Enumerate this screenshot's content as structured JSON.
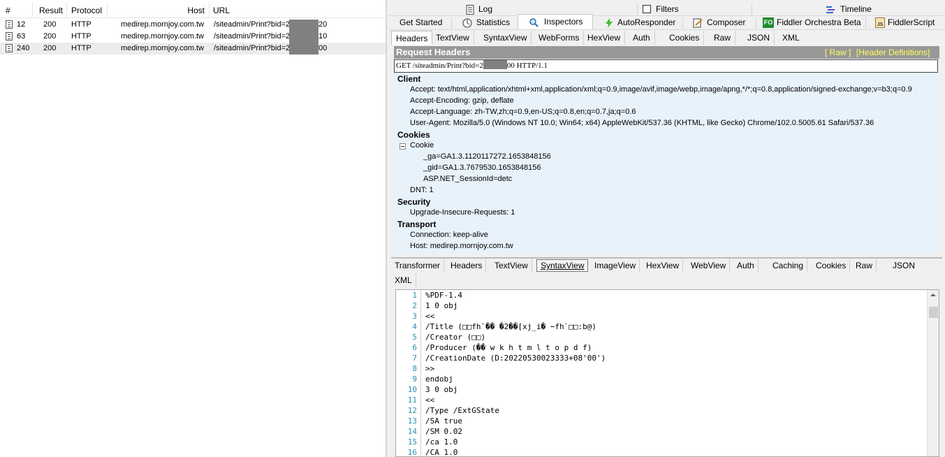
{
  "sessions": {
    "columns": [
      "#",
      "Result",
      "Protocol",
      "Host",
      "URL"
    ],
    "rows": [
      {
        "id": "12",
        "result": "200",
        "protocol": "HTTP",
        "host": "medirep.mornjoy.com.tw",
        "url": "/siteadmin/Print?bid=2",
        "url_tail": "20"
      },
      {
        "id": "63",
        "result": "200",
        "protocol": "HTTP",
        "host": "medirep.mornjoy.com.tw",
        "url": "/siteadmin/Print?bid=2",
        "url_tail": "10"
      },
      {
        "id": "240",
        "result": "200",
        "protocol": "HTTP",
        "host": "medirep.mornjoy.com.tw",
        "url": "/siteadmin/Print?bid=2",
        "url_tail": "00"
      }
    ]
  },
  "toptabs": {
    "log": "Log",
    "filters": "Filters",
    "timeline": "Timeline",
    "get_started": "Get Started",
    "statistics": "Statistics",
    "inspectors": "Inspectors",
    "autoresponder": "AutoResponder",
    "composer": "Composer",
    "orchestra": "Fiddler Orchestra Beta",
    "orchestra_badge": "FO",
    "fiddlerscript": "FiddlerScript",
    "fiddlerscript_badge": "JS"
  },
  "request_tabs": [
    "Headers",
    "TextView",
    "SyntaxView",
    "WebForms",
    "HexView",
    "Auth",
    "Cookies",
    "Raw",
    "JSON",
    "XML"
  ],
  "request_headers": {
    "title": "Request Headers",
    "raw_link": "[ Raw ]",
    "defs_link": "[Header Definitions]",
    "request_line_start": "GET /siteadmin/Print?bid=2",
    "request_line_end": "00 HTTP/1.1",
    "client_label": "Client",
    "accept": "Accept: text/html,application/xhtml+xml,application/xml;q=0.9,image/avif,image/webp,image/apng,*/*;q=0.8,application/signed-exchange;v=b3;q=0.9",
    "accept_encoding": "Accept-Encoding: gzip, deflate",
    "accept_language": "Accept-Language: zh-TW,zh;q=0.9,en-US;q=0.8,en;q=0.7,ja;q=0.6",
    "user_agent": "User-Agent: Mozilla/5.0 (Windows NT 10.0; Win64; x64) AppleWebKit/537.36 (KHTML, like Gecko) Chrome/102.0.5005.61 Safari/537.36",
    "cookies_label": "Cookies",
    "cookie_node": "Cookie",
    "ga": "_ga=GA1.3.1120117272.1653848156",
    "gid": "_gid=GA1.3.7679530.1653848156",
    "session": "ASP.NET_SessionId=detc",
    "dnt": "DNT: 1",
    "security_label": "Security",
    "upgrade": "Upgrade-Insecure-Requests: 1",
    "transport_label": "Transport",
    "connection": "Connection: keep-alive",
    "host": "Host: medirep.mornjoy.com.tw"
  },
  "response_tabs": [
    "Transformer",
    "Headers",
    "TextView",
    "SyntaxView",
    "ImageView",
    "HexView",
    "WebView",
    "Auth",
    "Caching",
    "Cookies",
    "Raw",
    "JSON",
    "XML"
  ],
  "syntax": {
    "line_numbers": [
      "1",
      "2",
      "3",
      "4",
      "5",
      "6",
      "7",
      "8",
      "9",
      "10",
      "11",
      "12",
      "13",
      "14",
      "15",
      "16"
    ],
    "lines": [
      "%PDF-1.4",
      "1 0 obj",
      "<<",
      "/Title (□□fh`�� �2��[xj_i� −fh`□□:b@)",
      "/Creator (□□)",
      "/Producer (�� w k h t m l t o p d f)",
      "/CreationDate (D:20220530023333+08'00')",
      ">>",
      "endobj",
      "3 0 obj",
      "<<",
      "/Type /ExtGState",
      "/SA true",
      "/SM 0.02",
      "/ca 1.0",
      "/CA 1.0"
    ]
  },
  "colors": {
    "header_bar": "#989898",
    "link_yellow": "#ffff5a",
    "line_number": "#2b91af",
    "panel_bg": "#e8f2fb"
  }
}
